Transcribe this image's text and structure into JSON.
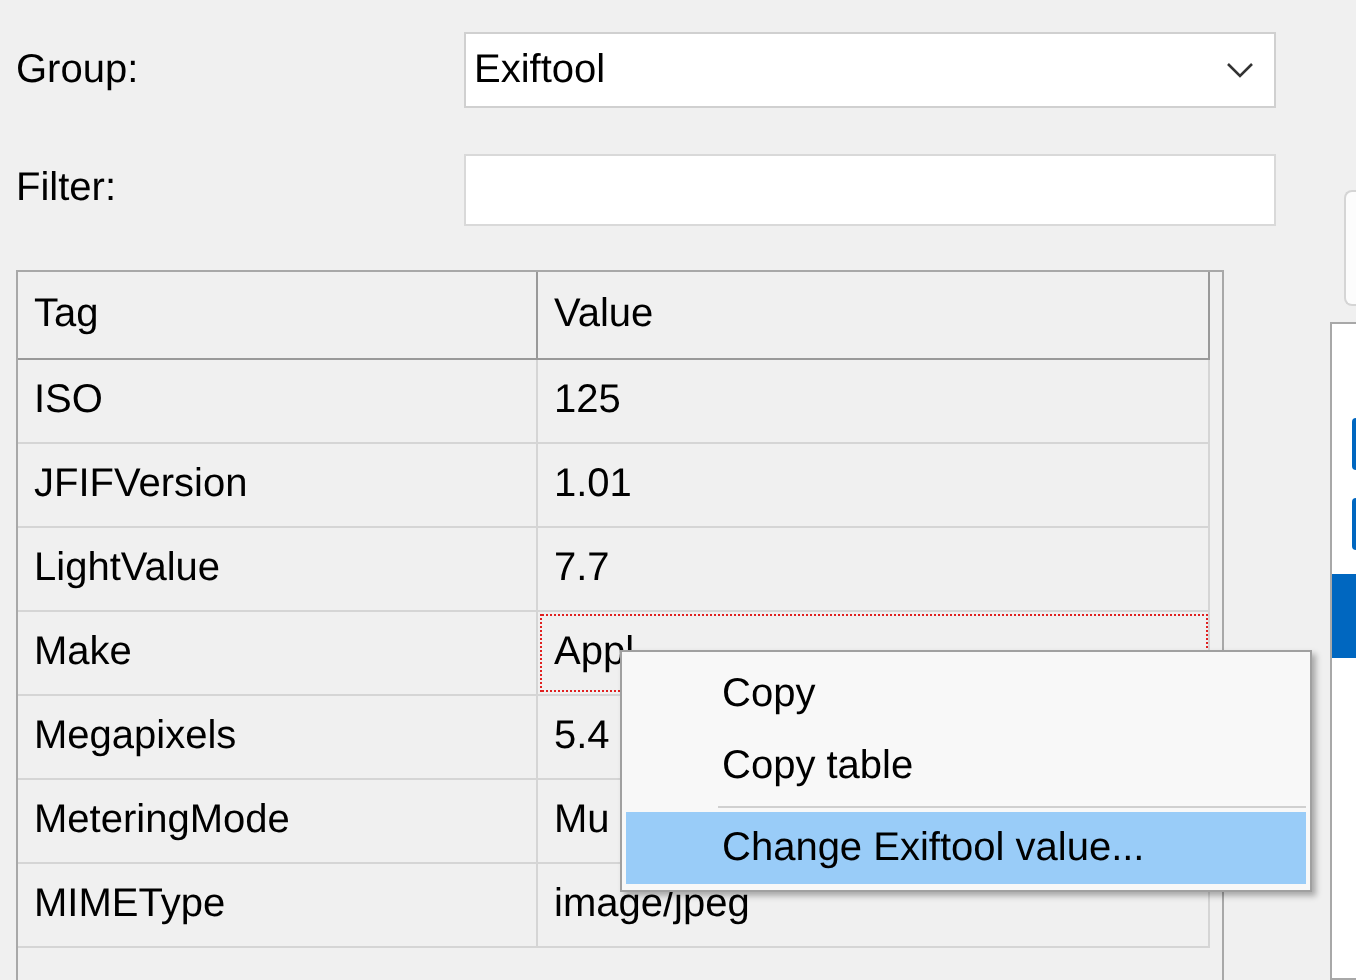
{
  "group": {
    "label": "Group:",
    "value": "Exiftool"
  },
  "filter": {
    "label": "Filter:"
  },
  "table": {
    "columns": [
      "Tag",
      "Value"
    ],
    "rows": [
      {
        "tag": "ISO",
        "value": "125",
        "focused": false
      },
      {
        "tag": "JFIFVersion",
        "value": "1.01",
        "focused": false
      },
      {
        "tag": "LightValue",
        "value": "7.7",
        "focused": false
      },
      {
        "tag": "Make",
        "value": "Appl",
        "focused": true
      },
      {
        "tag": "Megapixels",
        "value": "5.4",
        "focused": false
      },
      {
        "tag": "MeteringMode",
        "value": "Mu",
        "focused": false
      },
      {
        "tag": "MIMEType",
        "value": "image/jpeg",
        "focused": false
      }
    ]
  },
  "context_menu": {
    "items": [
      {
        "kind": "item",
        "label": "Copy",
        "selected": false
      },
      {
        "kind": "item",
        "label": "Copy table",
        "selected": false
      },
      {
        "kind": "separator"
      },
      {
        "kind": "item",
        "label": "Change Exiftool value...",
        "selected": true
      }
    ]
  },
  "side_list": {
    "items": [
      {
        "selected": false
      },
      {
        "selected": false
      },
      {
        "selected": true
      }
    ]
  }
}
